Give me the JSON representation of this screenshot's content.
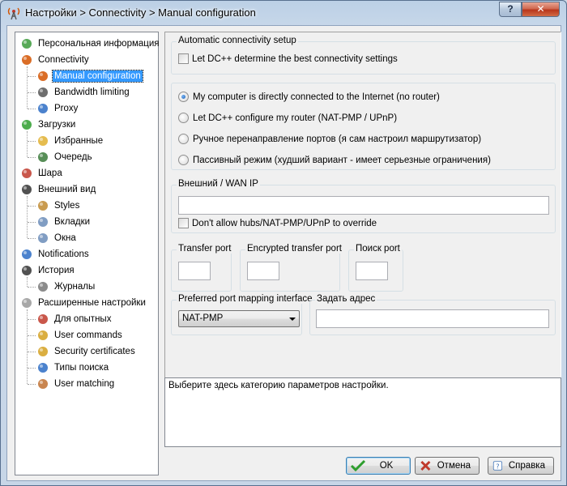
{
  "window": {
    "title": "Настройки > Connectivity > Manual configuration",
    "help_glyph": "?",
    "close_glyph": "✕"
  },
  "tree": {
    "items": [
      {
        "label": "Персональная информация",
        "icon": "user-green-icon",
        "level": 0
      },
      {
        "label": "Connectivity",
        "icon": "antenna-icon",
        "level": 0
      },
      {
        "label": "Manual configuration",
        "icon": "antenna-icon",
        "level": 1,
        "selected": true
      },
      {
        "label": "Bandwidth limiting",
        "icon": "gauge-icon",
        "level": 1
      },
      {
        "label": "Proxy",
        "icon": "globe-icon",
        "level": 1
      },
      {
        "label": "Загрузки",
        "icon": "download-arrow-icon",
        "level": 0
      },
      {
        "label": "Избранные",
        "icon": "favorites-folder-icon",
        "level": 1
      },
      {
        "label": "Очередь",
        "icon": "queue-clock-icon",
        "level": 1
      },
      {
        "label": "Шара",
        "icon": "upload-arrow-icon",
        "level": 0
      },
      {
        "label": "Внешний вид",
        "icon": "eye-icon",
        "level": 0
      },
      {
        "label": "Styles",
        "icon": "palette-icon",
        "level": 1
      },
      {
        "label": "Вкладки",
        "icon": "tabs-icon",
        "level": 1
      },
      {
        "label": "Окна",
        "icon": "windows-icon",
        "level": 1
      },
      {
        "label": "Notifications",
        "icon": "bell-info-icon",
        "level": 0
      },
      {
        "label": "История",
        "icon": "history-clock-icon",
        "level": 0
      },
      {
        "label": "Журналы",
        "icon": "log-pen-icon",
        "level": 1
      },
      {
        "label": "Расширенные настройки",
        "icon": "gears-icon",
        "level": 0
      },
      {
        "label": "Для опытных",
        "icon": "tools-icon",
        "level": 1
      },
      {
        "label": "User commands",
        "icon": "key-icon",
        "level": 1
      },
      {
        "label": "Security certificates",
        "icon": "lock-icon",
        "level": 1
      },
      {
        "label": "Типы поиска",
        "icon": "magnifier-icon",
        "level": 1
      },
      {
        "label": "User matching",
        "icon": "users-icon",
        "level": 1
      }
    ]
  },
  "auto": {
    "title": "Automatic connectivity setup",
    "checkbox_label": "Let DC++ determine the best connectivity settings"
  },
  "mode": {
    "options": [
      {
        "label": "My computer is directly connected to the Internet (no router)",
        "checked": true
      },
      {
        "label": "Let DC++ configure my router (NAT-PMP / UPnP)",
        "checked": false
      },
      {
        "label": "Ручное перенаправление портов (я сам настроил маршрутизатор)",
        "checked": false
      },
      {
        "label": "Пассивный режим (худший вариант - имеет серьезные ограничения)",
        "checked": false
      }
    ]
  },
  "wan": {
    "title": "Внешний / WAN IP",
    "value": "",
    "override_label": "Don't allow hubs/NAT-PMP/UPnP to override"
  },
  "ports": {
    "transfer_title": "Transfer port",
    "encrypted_title": "Encrypted transfer port",
    "search_title": "Поиск port",
    "transfer_value": "",
    "encrypted_value": "",
    "search_value": ""
  },
  "mapping": {
    "title": "Preferred port mapping interface",
    "selected": "NAT-PMP"
  },
  "bind": {
    "title": "Задать адрес",
    "value": ""
  },
  "description": "Выберите здесь категорию параметров настройки.",
  "buttons": {
    "ok": "OK",
    "cancel": "Отмена",
    "help": "Справка"
  }
}
